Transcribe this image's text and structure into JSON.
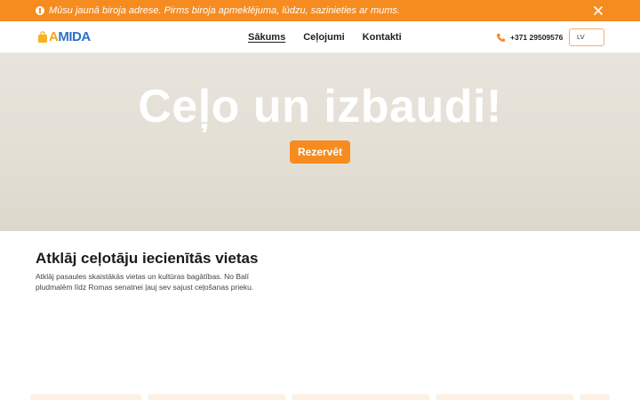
{
  "announcement": {
    "icon": "info-icon",
    "message": "Mūsu jaunā biroja adrese. Pirms biroja apmeklējuma, lūdzu, sazinieties ar mums.",
    "close_icon": "close-icon",
    "background": "#f68c1f"
  },
  "header": {
    "logo": {
      "text_prefix": "A",
      "text_rest": "MIDA",
      "icon": "suitcase-icon"
    },
    "nav": [
      {
        "label": "Sākums",
        "active": true
      },
      {
        "label": "Ceļojumi",
        "active": false
      },
      {
        "label": "Kontakti",
        "active": false
      }
    ],
    "phone": {
      "icon": "phone-icon",
      "number": "+371 29509576"
    },
    "language": {
      "selected": "LV"
    }
  },
  "hero": {
    "title": "Ceļo un izbaudi!",
    "cta_label": "Rezervēt"
  },
  "section": {
    "title": "Atklāj ceļotāju iecienītās vietas",
    "description": "Atklāj pasaules skaistākās vietas un kultūras bagātības. No Balī pludmalēm līdz Romas senatnei ļauj sev sajust ceļošanas prieku."
  },
  "colors": {
    "accent": "#f68c1f",
    "brand_blue": "#2b73c4",
    "card_tint": "#fdf1e6"
  }
}
